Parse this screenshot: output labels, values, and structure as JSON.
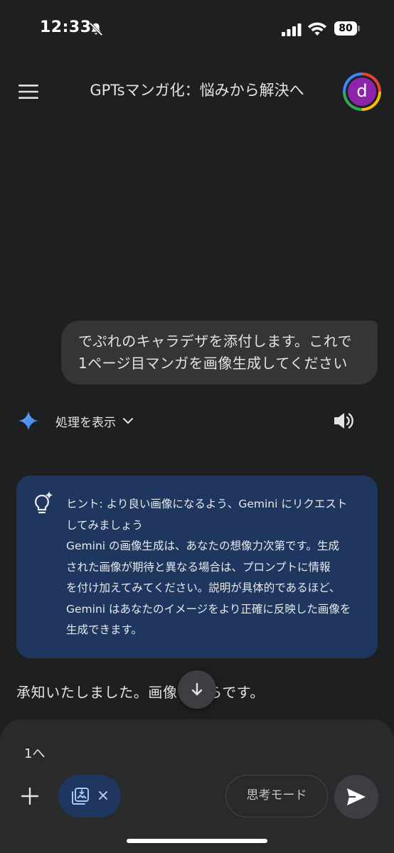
{
  "status_bar": {
    "time": "12:33",
    "battery": "80"
  },
  "header": {
    "title": "GPTsマンガ化：悩みから解決へ",
    "avatar_letter": "d"
  },
  "user_message": {
    "lines": [
      "でぷれのキャラデザを添付します。これで",
      "1ページ目マンガを画像生成してください"
    ]
  },
  "response": {
    "show_thinking_label": "処理を表示",
    "hint_lines": [
      "ヒント: より良い画像になるよう、Gemini にリクエスト",
      "してみましょう",
      "Gemini の画像生成は、あなたの想像力次第です。生成",
      "された画像が期待と異なる場合は、プロンプトに情報",
      "を付け加えてみてください。説明が具体的であるほど、",
      "Gemini はあなたのイメージをより正確に反映した画像を",
      "生成できます。"
    ],
    "answer_partial_before": "承知いたしました。画像",
    "answer_partial_after": "ちらです。"
  },
  "composer": {
    "input_value": "1へ",
    "thinking_mode_label": "思考モード"
  },
  "colors": {
    "background": "#1e1f20",
    "hint_card": "#1f365e",
    "user_bubble": "#333537",
    "accent_spark": "#4285f4"
  },
  "icons": [
    "bell-off-icon",
    "signal-icon",
    "wifi-icon",
    "battery-icon",
    "menu-icon",
    "gemini-spark-icon",
    "chevron-down-icon",
    "speaker-icon",
    "lightbulb-icon",
    "arrow-down-icon",
    "add-icon",
    "image-attach-icon",
    "close-icon",
    "send-icon"
  ]
}
